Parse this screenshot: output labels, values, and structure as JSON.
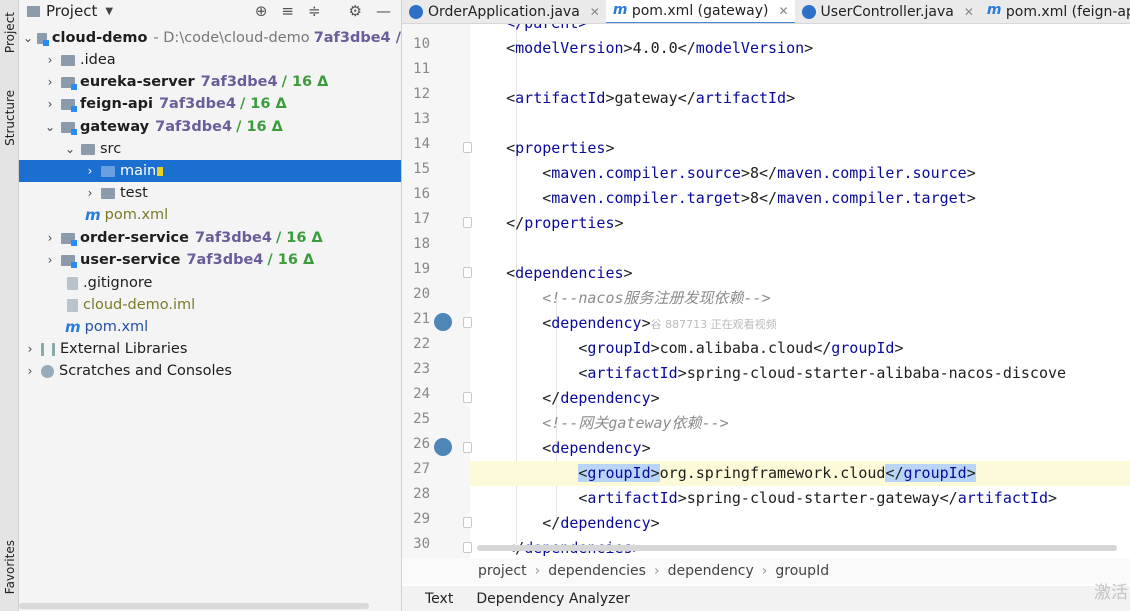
{
  "left_strip": {
    "project_tab": "Project",
    "structure_tab": "Structure",
    "favorites_tab": "Favorites"
  },
  "project_panel": {
    "title": "Project",
    "tree": [
      {
        "name": "cloud-demo",
        "path": "- D:\\code\\cloud-demo",
        "vcs": "7af3dbe4 /"
      },
      {
        "name": ".idea"
      },
      {
        "name": "eureka-server",
        "vcs": "7af3dbe4",
        "delta": "/ 16 Δ"
      },
      {
        "name": "feign-api",
        "vcs": "7af3dbe4",
        "delta": "/ 16 Δ"
      },
      {
        "name": "gateway",
        "vcs": "7af3dbe4",
        "delta": "/ 16 Δ"
      },
      {
        "name": "src"
      },
      {
        "name": "main"
      },
      {
        "name": "test"
      },
      {
        "name": "pom.xml"
      },
      {
        "name": "order-service",
        "vcs": "7af3dbe4",
        "delta": "/ 16 Δ"
      },
      {
        "name": "user-service",
        "vcs": "7af3dbe4",
        "delta": "/ 16 Δ"
      },
      {
        "name": ".gitignore"
      },
      {
        "name": "cloud-demo.iml"
      },
      {
        "name": "pom.xml"
      },
      {
        "name": "External Libraries"
      },
      {
        "name": "Scratches and Consoles"
      }
    ]
  },
  "tabs": [
    {
      "label": "OrderApplication.java"
    },
    {
      "label": "pom.xml (gateway)"
    },
    {
      "label": "UserController.java"
    },
    {
      "label": "pom.xml (feign-ap"
    }
  ],
  "editor": {
    "partial_top": "</parent>",
    "lines": [
      {
        "n": "10"
      },
      {
        "n": "11"
      },
      {
        "n": "12"
      },
      {
        "n": "13"
      },
      {
        "n": "14"
      },
      {
        "n": "15"
      },
      {
        "n": "16"
      },
      {
        "n": "17"
      },
      {
        "n": "18"
      },
      {
        "n": "19"
      },
      {
        "n": "20"
      },
      {
        "n": "21"
      },
      {
        "n": "22"
      },
      {
        "n": "23"
      },
      {
        "n": "24"
      },
      {
        "n": "25"
      },
      {
        "n": "26"
      },
      {
        "n": "27"
      },
      {
        "n": "28"
      },
      {
        "n": "29"
      },
      {
        "n": "30"
      }
    ],
    "text": {
      "model_version": "4.0.0",
      "artifact_id": "gateway",
      "compiler_source": "8",
      "compiler_target": "8",
      "comment_nacos": "<!--nacos服务注册发现依赖-->",
      "ghost_overlay": "谷 887713 正在观看视频",
      "group_alibaba": "com.alibaba.cloud",
      "artifact_nacos": "spring-cloud-starter-alibaba-nacos-discove",
      "comment_gateway": "<!--网关gateway依赖-->",
      "group_spring": "org.springframework.cloud",
      "artifact_gateway": "spring-cloud-starter-gateway"
    }
  },
  "breadcrumb": [
    "project",
    "dependencies",
    "dependency",
    "groupId"
  ],
  "bottom_tabs": [
    "Text",
    "Dependency Analyzer"
  ],
  "watermark": "激活"
}
